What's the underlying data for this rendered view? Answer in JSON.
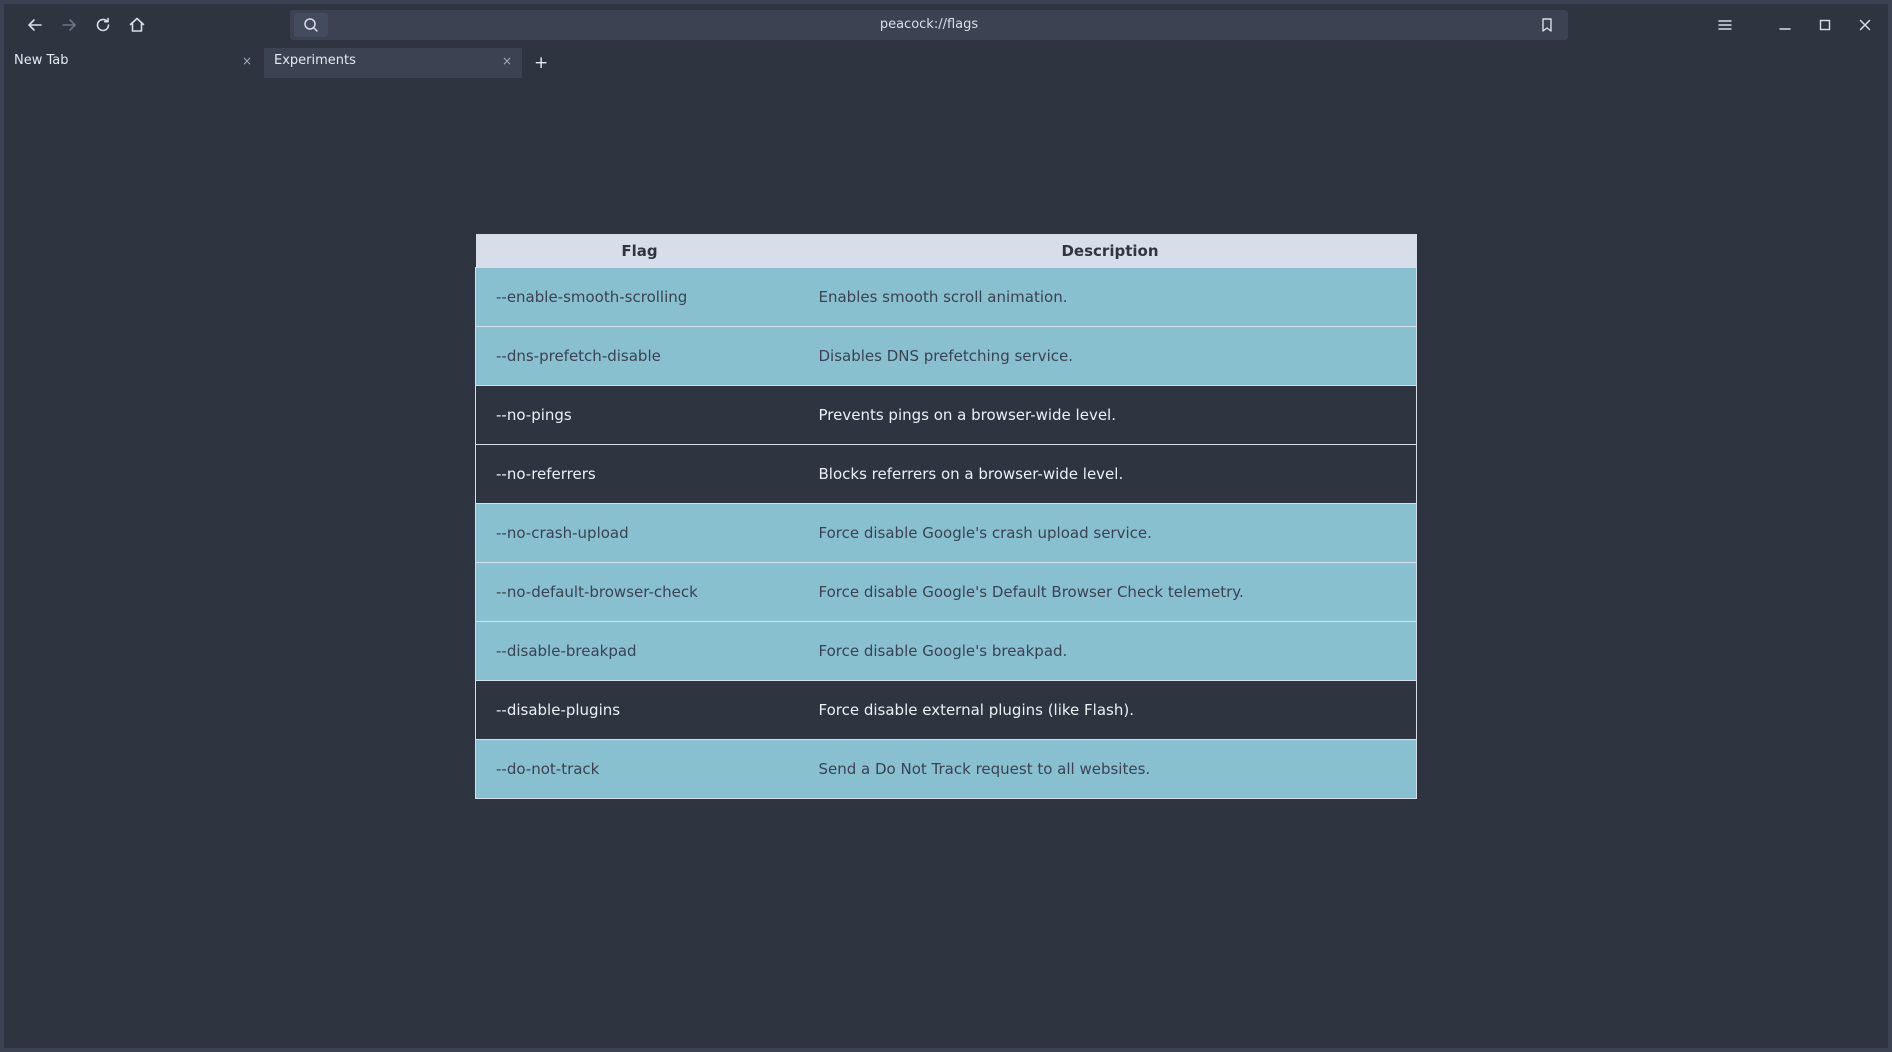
{
  "toolbar": {
    "url": "peacock://flags",
    "icon_color": "#d8dee9"
  },
  "tabs": [
    {
      "label": "New Tab",
      "close": "×"
    },
    {
      "label": "Experiments",
      "close": "×"
    }
  ],
  "new_tab_label": "+",
  "table": {
    "headers": [
      "Flag",
      "Description"
    ],
    "rows": [
      {
        "flag": "--enable-smooth-scrolling",
        "description": "Enables smooth scroll animation.",
        "highlighted": true
      },
      {
        "flag": "--dns-prefetch-disable",
        "description": "Disables DNS prefetching service.",
        "highlighted": true
      },
      {
        "flag": "--no-pings",
        "description": "Prevents pings on a browser-wide level.",
        "highlighted": false
      },
      {
        "flag": "--no-referrers",
        "description": "Blocks referrers on a browser-wide level.",
        "highlighted": false
      },
      {
        "flag": "--no-crash-upload",
        "description": "Force disable Google's crash upload service.",
        "highlighted": true
      },
      {
        "flag": "--no-default-browser-check",
        "description": "Force disable Google's Default Browser Check telemetry.",
        "highlighted": true
      },
      {
        "flag": "--disable-breakpad",
        "description": "Force disable Google's breakpad.",
        "highlighted": true
      },
      {
        "flag": "--disable-plugins",
        "description": "Force disable external plugins (like Flash).",
        "highlighted": false
      },
      {
        "flag": "--do-not-track",
        "description": "Send a Do Not Track request to all websites.",
        "highlighted": true
      }
    ]
  },
  "colors": {
    "background": "#2e3440",
    "highlight_row": "#88c0d0",
    "header": "#d8dee9"
  }
}
